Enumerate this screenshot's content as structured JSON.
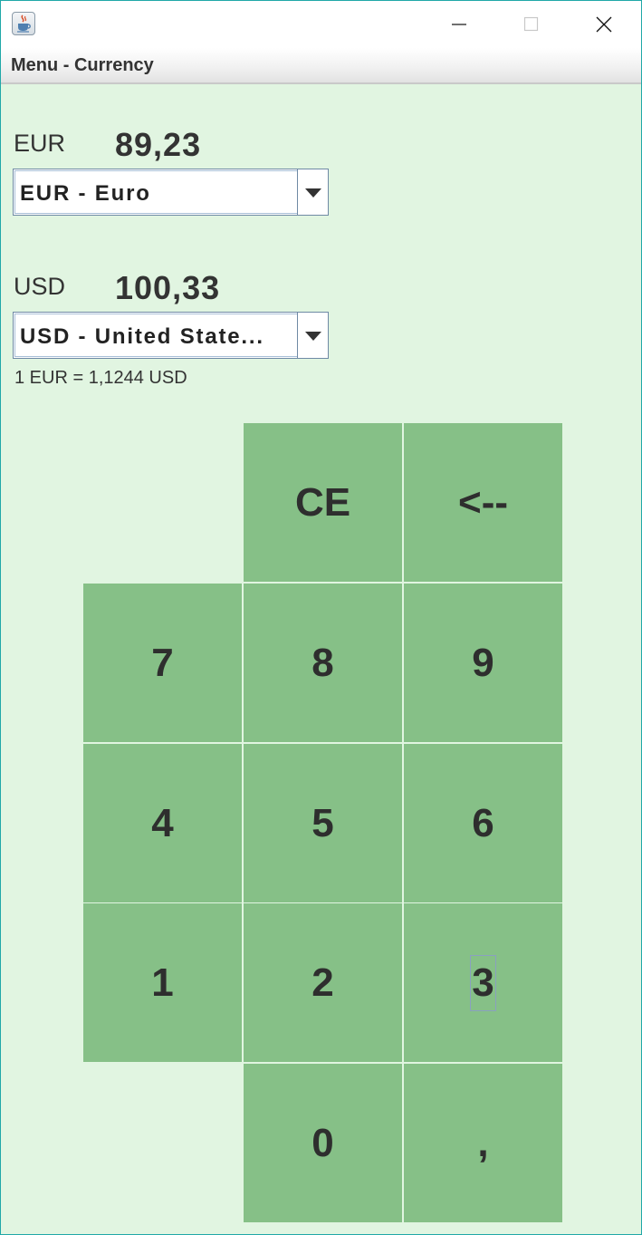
{
  "window": {
    "menu_title": "Menu - Currency",
    "icon": "java-coffee-icon"
  },
  "from": {
    "code": "EUR",
    "amount": "89,23",
    "selected": "EUR - Euro"
  },
  "to": {
    "code": "USD",
    "amount": "100,33",
    "selected": "USD - United State..."
  },
  "rate_text": "1 EUR = 1,1244 USD",
  "keypad": {
    "ce": "CE",
    "backspace": "<--",
    "k7": "7",
    "k8": "8",
    "k9": "9",
    "k4": "4",
    "k5": "5",
    "k6": "6",
    "k1": "1",
    "k2": "2",
    "k3": "3",
    "k0": "0",
    "comma": ","
  },
  "colors": {
    "background": "#e1f5e1",
    "key": "#86c087",
    "border": "#20a8a8"
  }
}
